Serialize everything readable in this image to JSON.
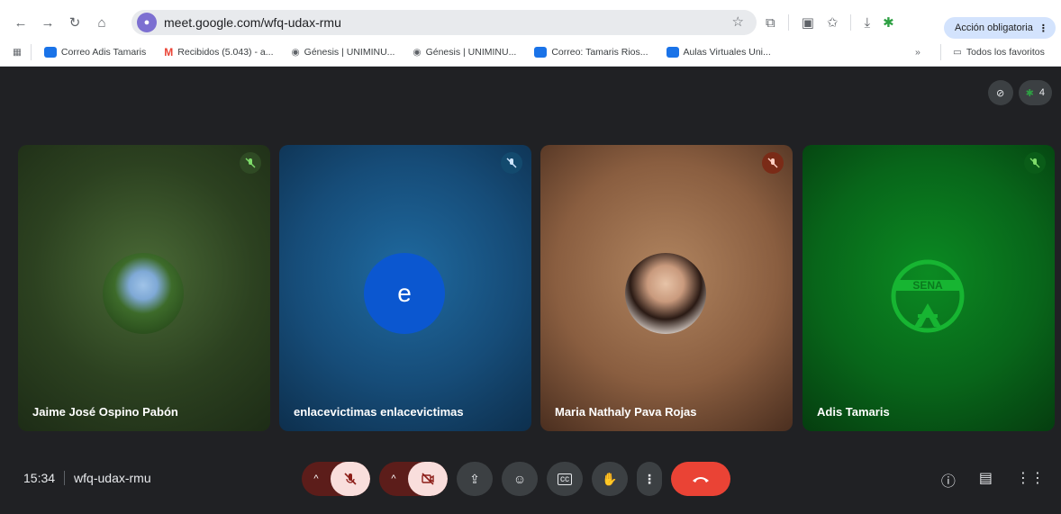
{
  "browser": {
    "url": "meet.google.com/wfq-udax-rmu",
    "action_pill_label": "Acción obligatoria",
    "bookmarks": [
      {
        "label": "Correo Adis Tamaris",
        "color": "#1a73e8"
      },
      {
        "label": "Recibidos (5.043) - a...",
        "color": "#ea4335"
      },
      {
        "label": "Génesis | UNIMINU...",
        "color": "#5f6368"
      },
      {
        "label": "Génesis | UNIMINU...",
        "color": "#5f6368"
      },
      {
        "label": "Correo: Tamaris Rios...",
        "color": "#1a73e8"
      },
      {
        "label": "Aulas Virtuales Uni...",
        "color": "#1a73e8"
      }
    ],
    "more_bookmarks": "»",
    "all_bookmarks": "Todos los favoritos"
  },
  "meet": {
    "participant_count": "4",
    "tiles": [
      {
        "name": "Jaime José Ospino Pabón",
        "bg_from": "#3f5a2e",
        "bg_to": "#1b2a16",
        "mic_bg": "#2f4a24",
        "mic_color": "#7fdc6a"
      },
      {
        "name": "enlacevictimas enlacevictimas",
        "bg_from": "#1f5f8f",
        "bg_to": "#0f3150",
        "mic_bg": "#134a6e",
        "mic_color": "#cfe6ff",
        "initial": "e"
      },
      {
        "name": "Maria Nathaly Pava Rojas",
        "bg_from": "#a77a5a",
        "bg_to": "#4c3020",
        "mic_bg": "#7a2b17",
        "mic_color": "#ffd0c4"
      },
      {
        "name": "Adis Tamaris",
        "bg_from": "#0a7a1e",
        "bg_to": "#063c0e",
        "mic_bg": "#0a5c18",
        "mic_color": "#7fdc6a"
      }
    ],
    "time": "15:34",
    "meeting_code": "wfq-udax-rmu"
  }
}
